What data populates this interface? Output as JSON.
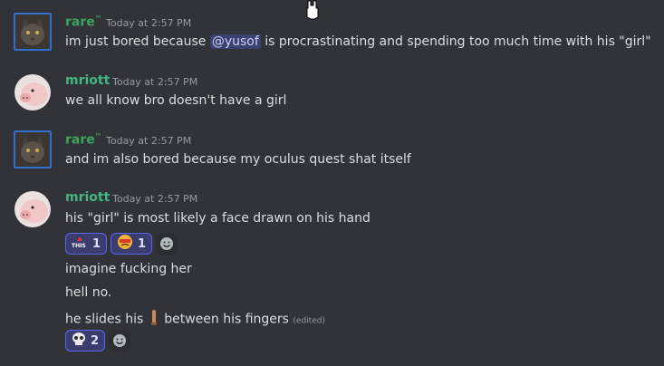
{
  "colors": {
    "background": "#313338",
    "rare_name": "#3ba55c",
    "mriott_name": "#43b581",
    "mention_bg": "#3c4270",
    "reaction_border": "#5865f2"
  },
  "messages": [
    {
      "author": "rare",
      "author_badge": "™",
      "avatar_icon": "cat-avatar-icon",
      "timestamp": "Today at 2:57 PM",
      "text_before": "im just bored because ",
      "mention": "@yusof",
      "text_after": " is procrastinating and spending too much time with his \"girl\""
    },
    {
      "author": "mriott",
      "avatar_icon": "pig-avatar-icon",
      "timestamp": "Today at 2:57 PM",
      "text": "we all know bro doesn't have a girl"
    },
    {
      "author": "rare",
      "author_badge": "™",
      "avatar_icon": "cat-avatar-icon",
      "timestamp": "Today at 2:57 PM",
      "text": "and im also bored because my oculus quest shat itself"
    },
    {
      "author": "mriott",
      "avatar_icon": "pig-avatar-icon",
      "timestamp": "Today at 2:57 PM",
      "text": "his \"girl\" is most likely a face drawn on his hand",
      "reactions": [
        {
          "emoji": "this-emoji",
          "emoji_text": "THIS",
          "count": "1"
        },
        {
          "emoji": "angry-face-emoji",
          "count": "1"
        }
      ]
    }
  ],
  "followups": [
    {
      "text": "imagine fucking her"
    },
    {
      "text": "hell no."
    },
    {
      "text_before": "he slides his ",
      "emoji": "finger-emoji",
      "text_after": " between his fingers",
      "edited": "(edited)"
    }
  ],
  "last_reactions": [
    {
      "emoji": "skull-emoji",
      "count": "2"
    }
  ]
}
